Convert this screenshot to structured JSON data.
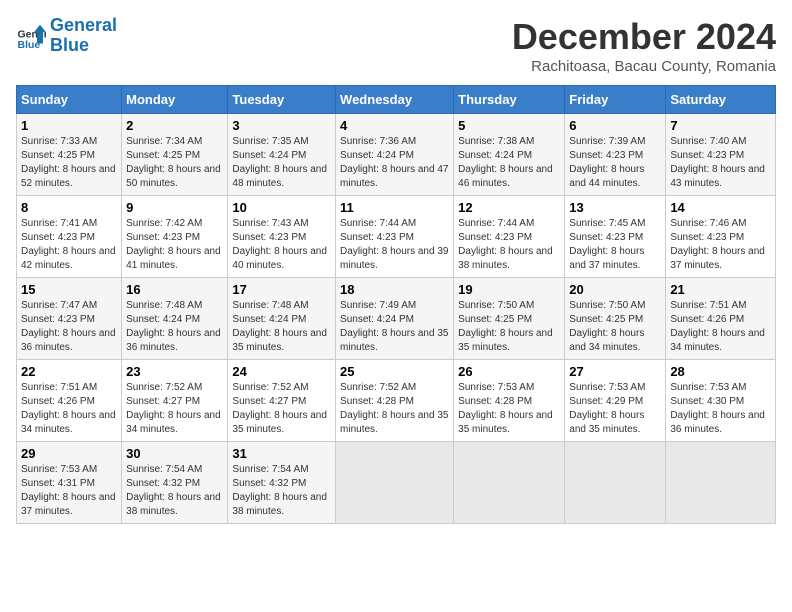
{
  "logo": {
    "line1": "General",
    "line2": "Blue"
  },
  "title": "December 2024",
  "subtitle": "Rachitoasa, Bacau County, Romania",
  "days_of_week": [
    "Sunday",
    "Monday",
    "Tuesday",
    "Wednesday",
    "Thursday",
    "Friday",
    "Saturday"
  ],
  "weeks": [
    [
      {
        "day": 1,
        "sunrise": "7:33 AM",
        "sunset": "4:25 PM",
        "daylight": "8 hours and 52 minutes."
      },
      {
        "day": 2,
        "sunrise": "7:34 AM",
        "sunset": "4:25 PM",
        "daylight": "8 hours and 50 minutes."
      },
      {
        "day": 3,
        "sunrise": "7:35 AM",
        "sunset": "4:24 PM",
        "daylight": "8 hours and 48 minutes."
      },
      {
        "day": 4,
        "sunrise": "7:36 AM",
        "sunset": "4:24 PM",
        "daylight": "8 hours and 47 minutes."
      },
      {
        "day": 5,
        "sunrise": "7:38 AM",
        "sunset": "4:24 PM",
        "daylight": "8 hours and 46 minutes."
      },
      {
        "day": 6,
        "sunrise": "7:39 AM",
        "sunset": "4:23 PM",
        "daylight": "8 hours and 44 minutes."
      },
      {
        "day": 7,
        "sunrise": "7:40 AM",
        "sunset": "4:23 PM",
        "daylight": "8 hours and 43 minutes."
      }
    ],
    [
      {
        "day": 8,
        "sunrise": "7:41 AM",
        "sunset": "4:23 PM",
        "daylight": "8 hours and 42 minutes."
      },
      {
        "day": 9,
        "sunrise": "7:42 AM",
        "sunset": "4:23 PM",
        "daylight": "8 hours and 41 minutes."
      },
      {
        "day": 10,
        "sunrise": "7:43 AM",
        "sunset": "4:23 PM",
        "daylight": "8 hours and 40 minutes."
      },
      {
        "day": 11,
        "sunrise": "7:44 AM",
        "sunset": "4:23 PM",
        "daylight": "8 hours and 39 minutes."
      },
      {
        "day": 12,
        "sunrise": "7:44 AM",
        "sunset": "4:23 PM",
        "daylight": "8 hours and 38 minutes."
      },
      {
        "day": 13,
        "sunrise": "7:45 AM",
        "sunset": "4:23 PM",
        "daylight": "8 hours and 37 minutes."
      },
      {
        "day": 14,
        "sunrise": "7:46 AM",
        "sunset": "4:23 PM",
        "daylight": "8 hours and 37 minutes."
      }
    ],
    [
      {
        "day": 15,
        "sunrise": "7:47 AM",
        "sunset": "4:23 PM",
        "daylight": "8 hours and 36 minutes."
      },
      {
        "day": 16,
        "sunrise": "7:48 AM",
        "sunset": "4:24 PM",
        "daylight": "8 hours and 36 minutes."
      },
      {
        "day": 17,
        "sunrise": "7:48 AM",
        "sunset": "4:24 PM",
        "daylight": "8 hours and 35 minutes."
      },
      {
        "day": 18,
        "sunrise": "7:49 AM",
        "sunset": "4:24 PM",
        "daylight": "8 hours and 35 minutes."
      },
      {
        "day": 19,
        "sunrise": "7:50 AM",
        "sunset": "4:25 PM",
        "daylight": "8 hours and 35 minutes."
      },
      {
        "day": 20,
        "sunrise": "7:50 AM",
        "sunset": "4:25 PM",
        "daylight": "8 hours and 34 minutes."
      },
      {
        "day": 21,
        "sunrise": "7:51 AM",
        "sunset": "4:26 PM",
        "daylight": "8 hours and 34 minutes."
      }
    ],
    [
      {
        "day": 22,
        "sunrise": "7:51 AM",
        "sunset": "4:26 PM",
        "daylight": "8 hours and 34 minutes."
      },
      {
        "day": 23,
        "sunrise": "7:52 AM",
        "sunset": "4:27 PM",
        "daylight": "8 hours and 34 minutes."
      },
      {
        "day": 24,
        "sunrise": "7:52 AM",
        "sunset": "4:27 PM",
        "daylight": "8 hours and 35 minutes."
      },
      {
        "day": 25,
        "sunrise": "7:52 AM",
        "sunset": "4:28 PM",
        "daylight": "8 hours and 35 minutes."
      },
      {
        "day": 26,
        "sunrise": "7:53 AM",
        "sunset": "4:28 PM",
        "daylight": "8 hours and 35 minutes."
      },
      {
        "day": 27,
        "sunrise": "7:53 AM",
        "sunset": "4:29 PM",
        "daylight": "8 hours and 35 minutes."
      },
      {
        "day": 28,
        "sunrise": "7:53 AM",
        "sunset": "4:30 PM",
        "daylight": "8 hours and 36 minutes."
      }
    ],
    [
      {
        "day": 29,
        "sunrise": "7:53 AM",
        "sunset": "4:31 PM",
        "daylight": "8 hours and 37 minutes."
      },
      {
        "day": 30,
        "sunrise": "7:54 AM",
        "sunset": "4:32 PM",
        "daylight": "8 hours and 38 minutes."
      },
      {
        "day": 31,
        "sunrise": "7:54 AM",
        "sunset": "4:32 PM",
        "daylight": "8 hours and 38 minutes."
      },
      null,
      null,
      null,
      null
    ]
  ]
}
